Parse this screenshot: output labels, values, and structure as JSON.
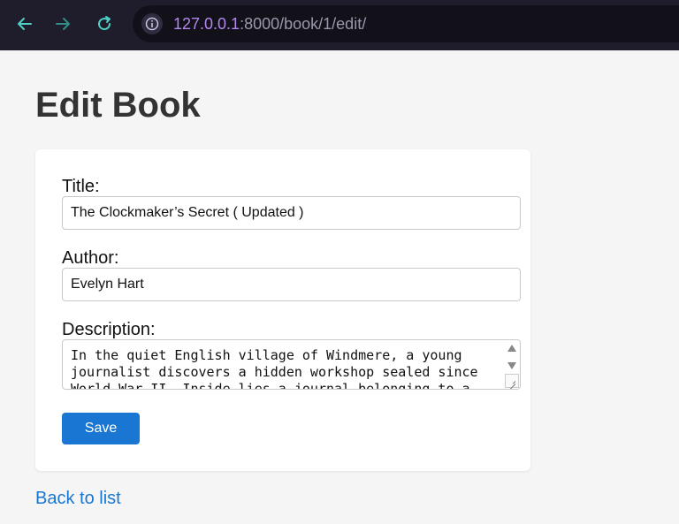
{
  "browser": {
    "url_host": "127.0.0.1",
    "url_rest": ":8000/book/1/edit/",
    "icons": {
      "back": "arrow-left-icon",
      "forward": "arrow-right-icon",
      "reload": "reload-icon",
      "site_info": "site-info-icon"
    },
    "icon_color_active": "#4fd1c5",
    "icon_color_inactive": "#2f8f86"
  },
  "page": {
    "title": "Edit Book",
    "back_link": "Back to list"
  },
  "form": {
    "title_label": "Title:",
    "title_value": "The Clockmaker’s Secret ( Updated )",
    "author_label": "Author:",
    "author_value": "Evelyn Hart",
    "description_label": "Description:",
    "description_value": "In the quiet English village of Windmere, a young journalist discovers a hidden workshop sealed since World War II. Inside lies a journal belonging to a",
    "save_label": "Save"
  },
  "colors": {
    "accent": "#1976d2",
    "page_background": "#f5f5f5",
    "browser_chrome": "#1f1d2b"
  }
}
